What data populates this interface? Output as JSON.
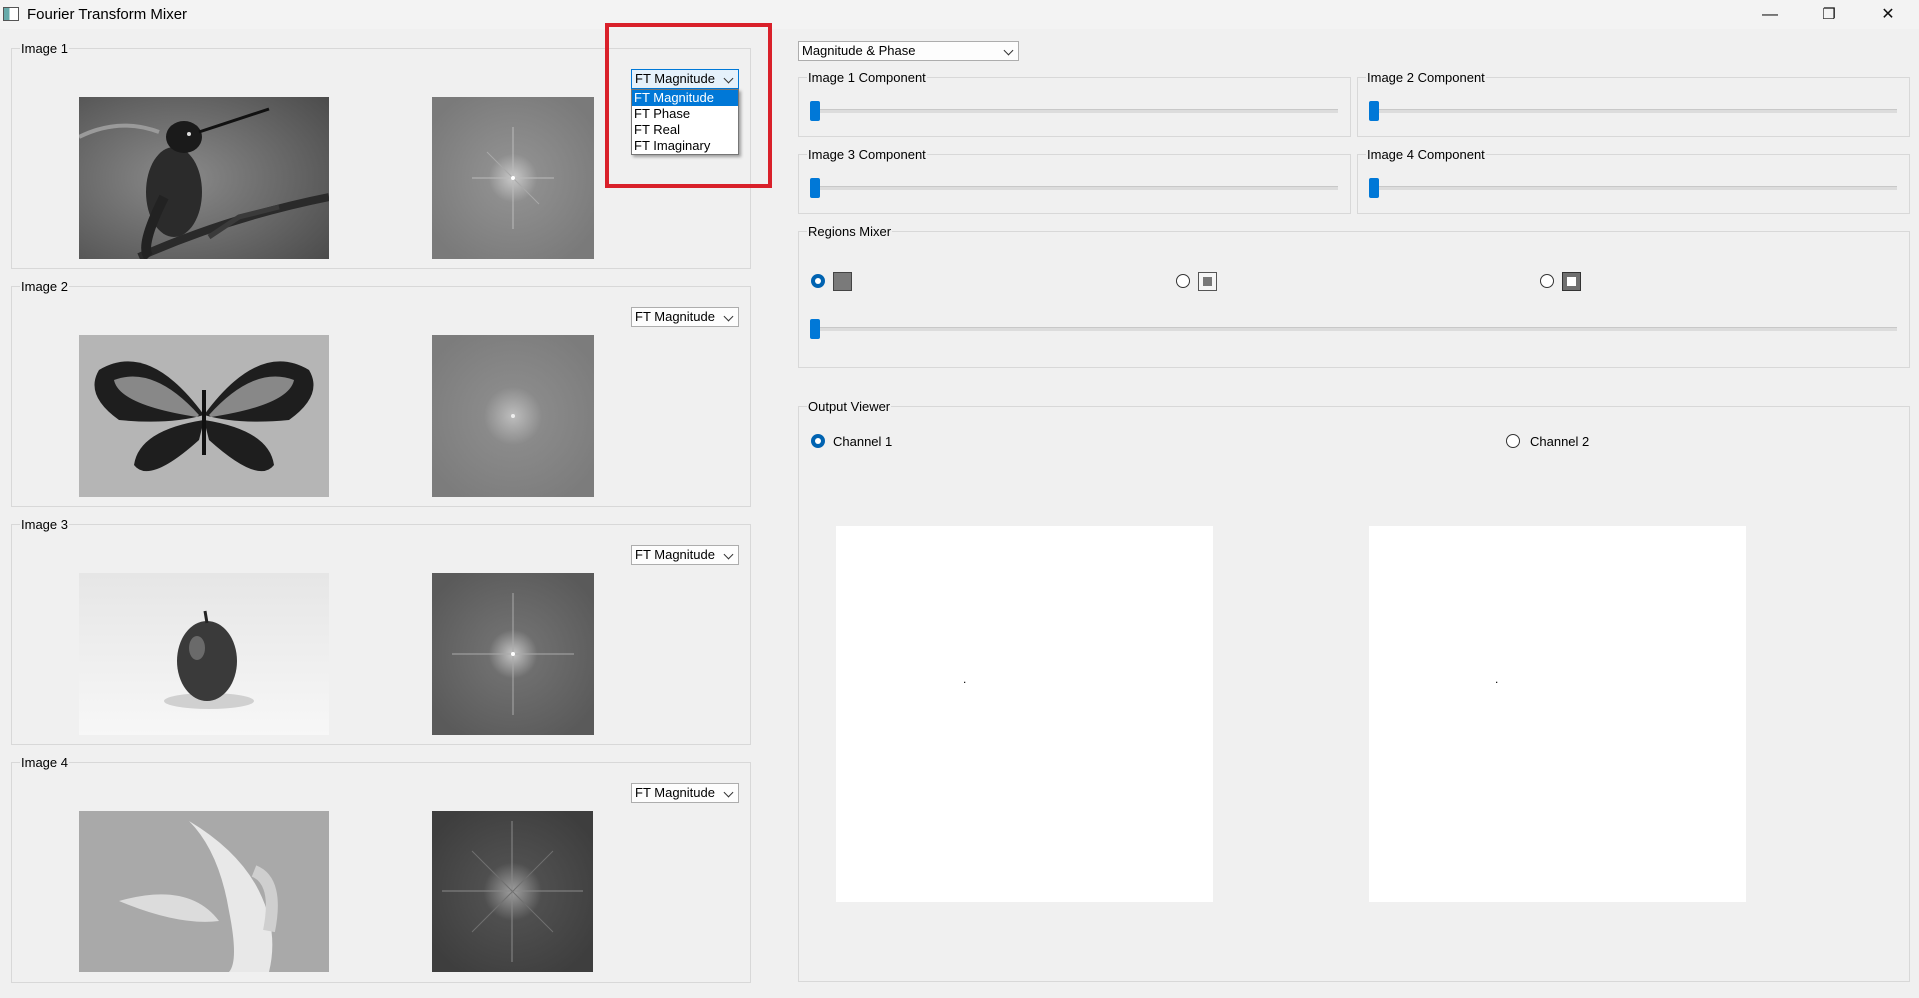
{
  "window": {
    "title": "Fourier Transform Mixer",
    "minimize_glyph": "—",
    "maximize_glyph": "❐",
    "close_glyph": "✕"
  },
  "images": [
    {
      "label": "Image 1",
      "component": "FT Magnitude"
    },
    {
      "label": "Image 2",
      "component": "FT Magnitude"
    },
    {
      "label": "Image 3",
      "component": "FT Magnitude"
    },
    {
      "label": "Image 4",
      "component": "FT Magnitude"
    }
  ],
  "component_dropdown_options": [
    "FT Magnitude",
    "FT Phase",
    "FT Real",
    "FT Imaginary"
  ],
  "dropdown_open_selected": "FT Magnitude",
  "mode_select": {
    "value": "Magnitude & Phase"
  },
  "component_sliders": [
    {
      "label": "Image 1 Component",
      "value": 0
    },
    {
      "label": "Image 2 Component",
      "value": 0
    },
    {
      "label": "Image 3 Component",
      "value": 0
    },
    {
      "label": "Image 4 Component",
      "value": 0
    }
  ],
  "regions_mixer": {
    "label": "Regions Mixer",
    "options": [
      {
        "icon": "full-region-icon",
        "selected": true
      },
      {
        "icon": "inner-region-icon",
        "selected": false
      },
      {
        "icon": "outer-region-icon",
        "selected": false
      }
    ],
    "slider_value": 0
  },
  "output_viewer": {
    "label": "Output Viewer",
    "channels": [
      {
        "label": "Channel 1",
        "selected": true
      },
      {
        "label": "Channel 2",
        "selected": false
      }
    ],
    "dot_glyph": "."
  },
  "colors": {
    "accent": "#0078d7",
    "highlight_box": "#d9202a"
  }
}
